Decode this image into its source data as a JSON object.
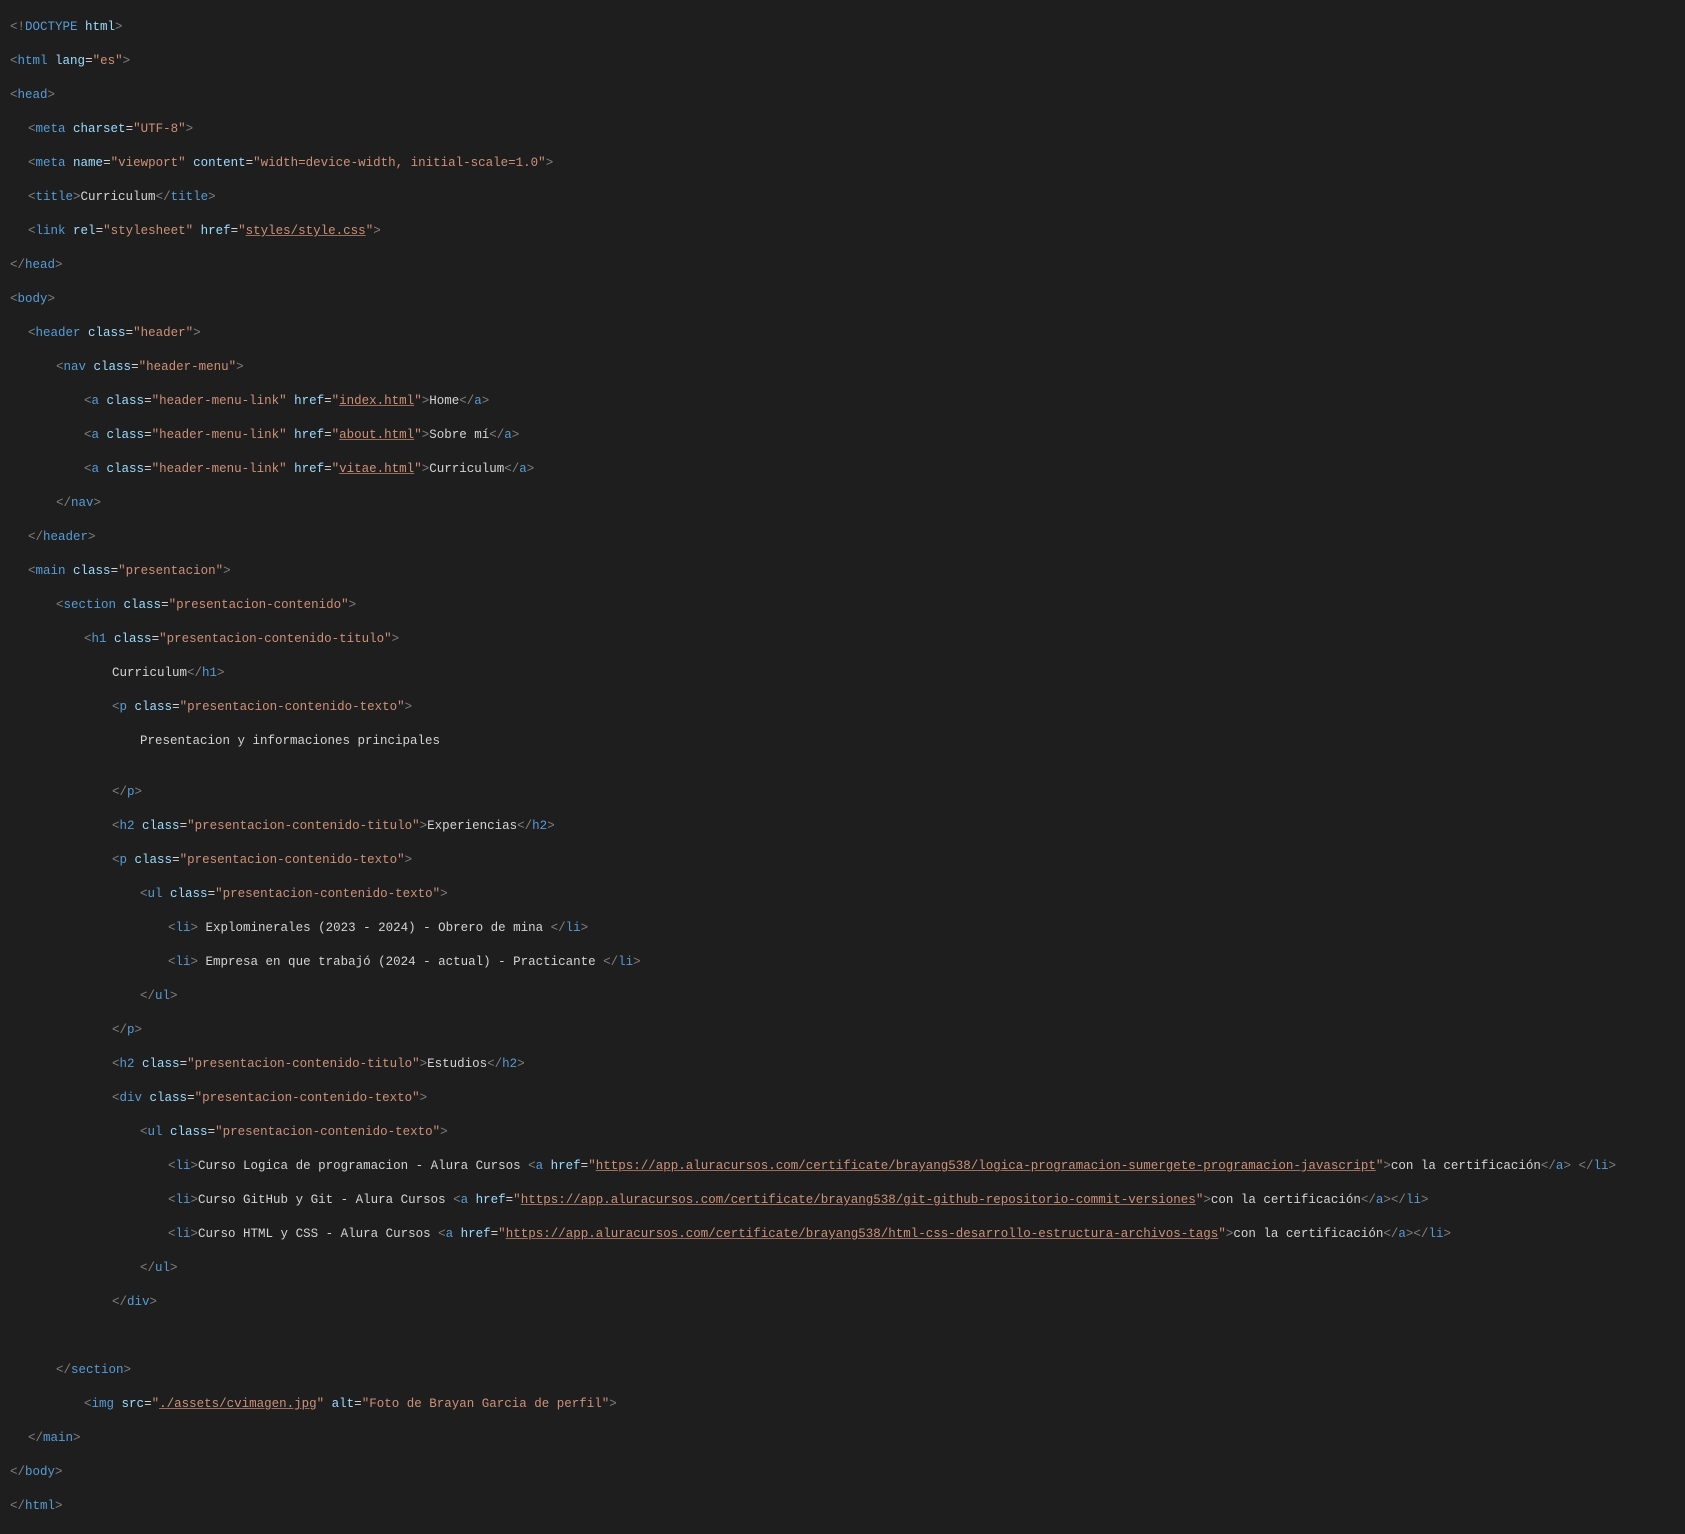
{
  "l1_dt": "<!",
  "l1_tag": "DOCTYPE",
  "l1_attr": " html",
  "l1_end": ">",
  "l2_o": "<",
  "l2_tag": "html",
  "l2_sp": " ",
  "l2_a1": "lang",
  "l2_eq": "=",
  "l2_v1": "\"es\"",
  "l2_c": ">",
  "l3_o": "<",
  "l3_tag": "head",
  "l3_c": ">",
  "l4_o": "<",
  "l4_tag": "meta",
  "l4_sp": " ",
  "l4_a1": "charset",
  "l4_eq": "=",
  "l4_v1": "\"UTF-8\"",
  "l4_c": ">",
  "l5_o": "<",
  "l5_tag": "meta",
  "l5_sp": " ",
  "l5_a1": "name",
  "l5_eq": "=",
  "l5_v1": "\"viewport\"",
  "l5_sp2": " ",
  "l5_a2": "content",
  "l5_v2": "\"width=device-width, initial-scale=1.0\"",
  "l5_c": ">",
  "l6_o": "<",
  "l6_tag": "title",
  "l6_c": ">",
  "l6_txt": "Curriculum",
  "l6_co": "</",
  "l6_cc": ">",
  "l7_o": "<",
  "l7_tag": "link",
  "l7_sp": " ",
  "l7_a1": "rel",
  "l7_eq": "=",
  "l7_v1": "\"stylesheet\"",
  "l7_sp2": " ",
  "l7_a2": "href",
  "l7_v2a": "\"",
  "l7_v2b": "styles/style.css",
  "l7_v2c": "\"",
  "l7_c": ">",
  "l8_o": "</",
  "l8_tag": "head",
  "l8_c": ">",
  "l9_o": "<",
  "l9_tag": "body",
  "l9_c": ">",
  "l10_o": "<",
  "l10_tag": "header",
  "l10_sp": " ",
  "l10_a1": "class",
  "l10_eq": "=",
  "l10_v1": "\"header\"",
  "l10_c": ">",
  "l11_o": "<",
  "l11_tag": "nav",
  "l11_sp": " ",
  "l11_a1": "class",
  "l11_eq": "=",
  "l11_v1": "\"header-menu\"",
  "l11_c": ">",
  "l12_o": "<",
  "l12_tag": "a",
  "l12_sp": " ",
  "l12_a1": "class",
  "l12_eq": "=",
  "l12_v1": "\"header-menu-link\"",
  "l12_sp2": " ",
  "l12_a2": "href",
  "l12_v2a": "\"",
  "l12_v2b": "index.html",
  "l12_v2c": "\"",
  "l12_c": ">",
  "l12_txt": "Home",
  "l12_co": "</",
  "l12_cc": ">",
  "l13_o": "<",
  "l13_tag": "a",
  "l13_sp": " ",
  "l13_a1": "class",
  "l13_eq": "=",
  "l13_v1": "\"header-menu-link\"",
  "l13_sp2": " ",
  "l13_a2": "href",
  "l13_v2a": "\"",
  "l13_v2b": "about.html",
  "l13_v2c": "\"",
  "l13_c": ">",
  "l13_txt": "Sobre mí",
  "l13_co": "</",
  "l13_cc": ">",
  "l14_o": "<",
  "l14_tag": "a",
  "l14_sp": " ",
  "l14_a1": "class",
  "l14_eq": "=",
  "l14_v1": "\"header-menu-link\"",
  "l14_sp2": " ",
  "l14_a2": "href",
  "l14_v2a": "\"",
  "l14_v2b": "vitae.html",
  "l14_v2c": "\"",
  "l14_c": ">",
  "l14_txt": "Curriculum",
  "l14_co": "</",
  "l14_cc": ">",
  "l15_o": "</",
  "l15_tag": "nav",
  "l15_c": ">",
  "l16_o": "</",
  "l16_tag": "header",
  "l16_c": ">",
  "l17_o": "<",
  "l17_tag": "main",
  "l17_sp": " ",
  "l17_a1": "class",
  "l17_eq": "=",
  "l17_v1": "\"presentacion\"",
  "l17_c": ">",
  "l18_o": "<",
  "l18_tag": "section",
  "l18_sp": " ",
  "l18_a1": "class",
  "l18_eq": "=",
  "l18_v1": "\"presentacion-contenido\"",
  "l18_c": ">",
  "l19_o": "<",
  "l19_tag": "h1",
  "l19_sp": " ",
  "l19_a1": "class",
  "l19_eq": "=",
  "l19_v1": "\"presentacion-contenido-titulo\"",
  "l19_c": ">",
  "l20_txt": "Curriculum",
  "l20_co": "</",
  "l20_tag": "h1",
  "l20_cc": ">",
  "l21_o": "<",
  "l21_tag": "p",
  "l21_sp": " ",
  "l21_a1": "class",
  "l21_eq": "=",
  "l21_v1": "\"presentacion-contenido-texto\"",
  "l21_c": ">",
  "l22_txt": "Presentacion y informaciones principales",
  "l24_o": "</",
  "l24_tag": "p",
  "l24_c": ">",
  "l25_o": "<",
  "l25_tag": "h2",
  "l25_sp": " ",
  "l25_a1": "class",
  "l25_eq": "=",
  "l25_v1": "\"presentacion-contenido-titulo\"",
  "l25_c": ">",
  "l25_txt": "Experiencias",
  "l25_co": "</",
  "l25_cc": ">",
  "l26_o": "<",
  "l26_tag": "p",
  "l26_sp": " ",
  "l26_a1": "class",
  "l26_eq": "=",
  "l26_v1": "\"presentacion-contenido-texto\"",
  "l26_c": ">",
  "l27_o": "<",
  "l27_tag": "ul",
  "l27_sp": " ",
  "l27_a1": "class",
  "l27_eq": "=",
  "l27_v1": "\"presentacion-contenido-texto\"",
  "l27_c": ">",
  "l28_o": "<",
  "l28_tag": "li",
  "l28_c": ">",
  "l28_txt": " Explominerales (2023 - 2024) - Obrero de mina ",
  "l28_co": "</",
  "l28_cc": ">",
  "l29_o": "<",
  "l29_tag": "li",
  "l29_c": ">",
  "l29_txt": " Empresa en que trabajó (2024 - actual) - Practicante ",
  "l29_co": "</",
  "l29_cc": ">",
  "l30_o": "</",
  "l30_tag": "ul",
  "l30_c": ">",
  "l31_o": "</",
  "l31_tag": "p",
  "l31_c": ">",
  "l32_o": "<",
  "l32_tag": "h2",
  "l32_sp": " ",
  "l32_a1": "class",
  "l32_eq": "=",
  "l32_v1": "\"presentacion-contenido-titulo\"",
  "l32_c": ">",
  "l32_txt": "Estudios",
  "l32_co": "</",
  "l32_cc": ">",
  "l33_o": "<",
  "l33_tag": "div",
  "l33_sp": " ",
  "l33_a1": "class",
  "l33_eq": "=",
  "l33_v1": "\"presentacion-contenido-texto\"",
  "l33_c": ">",
  "l34_o": "<",
  "l34_tag": "ul",
  "l34_sp": " ",
  "l34_a1": "class",
  "l34_eq": "=",
  "l34_v1": "\"presentacion-contenido-texto\"",
  "l34_c": ">",
  "l35_o": "<",
  "l35_tag": "li",
  "l35_c": ">",
  "l35_txt1": "Curso Logica de programacion - Alura Cursos ",
  "l35_ao": "<",
  "l35_atag": "a",
  "l35_asp": " ",
  "l35_aa": "href",
  "l35_aeq": "=",
  "l35_ava": "\"",
  "l35_avb": "https://app.aluracursos.com/certificate/brayang538/logica-programacion-sumergete-programacion-javascript",
  "l35_avc": "\"",
  "l35_ac": ">",
  "l35_atxt": "con la certificación",
  "l35_aco": "</",
  "l35_acc": ">",
  "l35_sp3": " ",
  "l35_co": "</",
  "l35_cc": ">",
  "l36_o": "<",
  "l36_tag": "li",
  "l36_c": ">",
  "l36_txt1": "Curso GitHub y Git - Alura Cursos ",
  "l36_ao": "<",
  "l36_atag": "a",
  "l36_asp": " ",
  "l36_aa": "href",
  "l36_aeq": "=",
  "l36_ava": "\"",
  "l36_avb": "https://app.aluracursos.com/certificate/brayang538/git-github-repositorio-commit-versiones",
  "l36_avc": "\"",
  "l36_ac": ">",
  "l36_atxt": "con la certificación",
  "l36_aco": "</",
  "l36_acc": ">",
  "l36_co": "</",
  "l36_cc": ">",
  "l37_o": "<",
  "l37_tag": "li",
  "l37_c": ">",
  "l37_txt1": "Curso HTML y CSS - Alura Cursos ",
  "l37_ao": "<",
  "l37_atag": "a",
  "l37_asp": " ",
  "l37_aa": "href",
  "l37_aeq": "=",
  "l37_ava": "\"",
  "l37_avb": "https://app.aluracursos.com/certificate/brayang538/html-css-desarrollo-estructura-archivos-tags",
  "l37_avc": "\"",
  "l37_ac": ">",
  "l37_atxt": "con la certificación",
  "l37_aco": "</",
  "l37_acc": ">",
  "l37_co": "</",
  "l37_cc": ">",
  "l38_o": "</",
  "l38_tag": "ul",
  "l38_c": ">",
  "l39_o": "</",
  "l39_tag": "div",
  "l39_c": ">",
  "l41_o": "</",
  "l41_tag": "section",
  "l41_c": ">",
  "l42_o": "<",
  "l42_tag": "img",
  "l42_sp": " ",
  "l42_a1": "src",
  "l42_eq": "=",
  "l42_v1a": "\"",
  "l42_v1b": "./assets/cvimagen.jpg",
  "l42_v1c": "\"",
  "l42_sp2": " ",
  "l42_a2": "alt",
  "l42_v2": "\"Foto de Brayan Garcia de perfil\"",
  "l42_c": ">",
  "l43_o": "</",
  "l43_tag": "main",
  "l43_c": ">",
  "l44_o": "</",
  "l44_tag": "body",
  "l44_c": ">",
  "l45_o": "</",
  "l45_tag": "html",
  "l45_c": ">"
}
